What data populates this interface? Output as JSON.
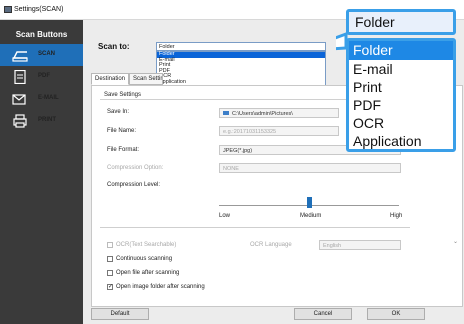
{
  "window": {
    "title": "Settings(SCAN)"
  },
  "sidebar": {
    "heading": "Scan Buttons",
    "items": [
      {
        "label": "SCAN",
        "icon": "scan-icon",
        "active": true
      },
      {
        "label": "PDF",
        "icon": "pdf-icon",
        "active": false
      },
      {
        "label": "E-MAIL",
        "icon": "email-icon",
        "active": false
      },
      {
        "label": "PRINT",
        "icon": "print-icon",
        "active": false
      }
    ]
  },
  "scan_to": {
    "label": "Scan to:",
    "selected": "Folder",
    "options": [
      "Folder",
      "E-mail",
      "Print",
      "PDF",
      "OCR",
      "Application"
    ]
  },
  "tabs": [
    "Destination",
    "Scan Settings"
  ],
  "settings": {
    "group_title": "Save Settings",
    "save_in_label": "Save In:",
    "save_in_value": "C:\\Users\\admin\\Pictures\\",
    "file_name_label": "File Name:",
    "file_name_value": "e.g.:20171031153325",
    "file_format_label": "File Format:",
    "file_format_value": "JPEG(*.jpg)",
    "compression_option_label": "Compression Option:",
    "compression_option_value": "NONE",
    "compression_level_label": "Compression Level:",
    "compression_level": {
      "low": "Low",
      "medium": "Medium",
      "high": "High"
    },
    "ocr_label": "OCR(Text Searchable)",
    "ocr_language_label": "OCR Language",
    "ocr_language_value": "English",
    "continuous_label": "Continuous scanning",
    "open_file_label": "Open file after scanning",
    "open_folder_label": "Open image folder after scanning",
    "open_folder_checked": true
  },
  "buttons": {
    "default": "Default",
    "cancel": "Cancel",
    "ok": "OK"
  },
  "callout": {
    "selected": "Folder",
    "options": [
      "Folder",
      "E-mail",
      "Print",
      "PDF",
      "OCR",
      "Application"
    ]
  },
  "colors": {
    "accent": "#1f6fb8",
    "sidebar": "#3a3a3a",
    "callout_border": "#3a9fe8"
  }
}
